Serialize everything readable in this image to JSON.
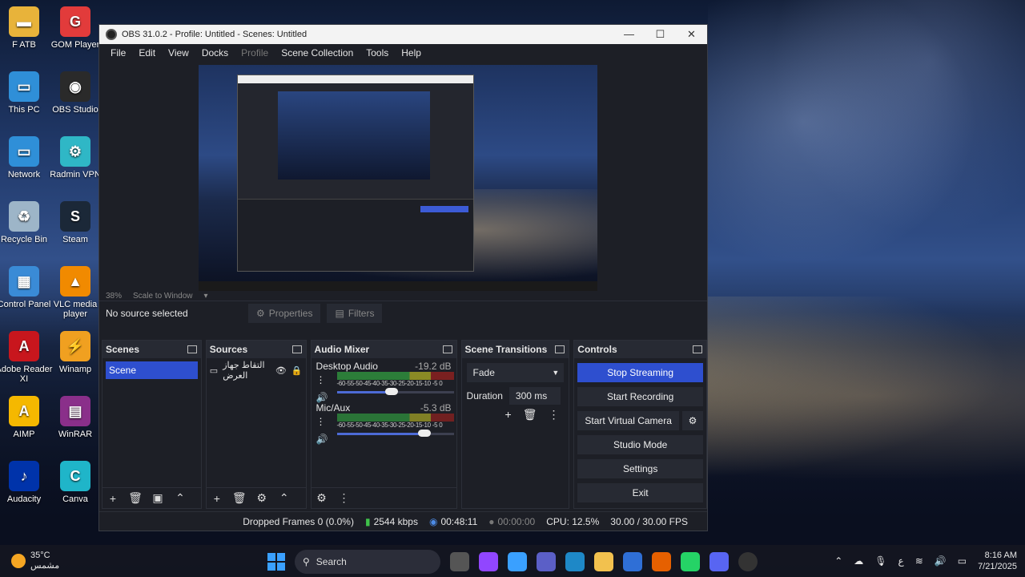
{
  "desktop_icons": [
    {
      "label": "F ATB",
      "color": "#e8b33a",
      "glyph": "▬"
    },
    {
      "label": "GOM Player",
      "color": "#e23b3b",
      "glyph": "G"
    },
    {
      "label": "This PC",
      "color": "#2f8fd8",
      "glyph": "▭"
    },
    {
      "label": "OBS Studio",
      "color": "#2a2a2a",
      "glyph": "◉"
    },
    {
      "label": "Network",
      "color": "#2f8fd8",
      "glyph": "▭"
    },
    {
      "label": "Radmin VPN",
      "color": "#2fb7c6",
      "glyph": "⚙"
    },
    {
      "label": "Recycle Bin",
      "color": "#9db5c8",
      "glyph": "♻"
    },
    {
      "label": "Steam",
      "color": "#1b2838",
      "glyph": "S"
    },
    {
      "label": "Control Panel",
      "color": "#3a8bd6",
      "glyph": "▦"
    },
    {
      "label": "VLC media player",
      "color": "#f18a00",
      "glyph": "▲"
    },
    {
      "label": "Adobe Reader XI",
      "color": "#c8161d",
      "glyph": "A"
    },
    {
      "label": "Winamp",
      "color": "#f0a020",
      "glyph": "⚡"
    },
    {
      "label": "AIMP",
      "color": "#f5b800",
      "glyph": "A"
    },
    {
      "label": "WinRAR",
      "color": "#8a2f8a",
      "glyph": "▤"
    },
    {
      "label": "Audacity",
      "color": "#0033aa",
      "glyph": "♪"
    },
    {
      "label": "Canva",
      "color": "#1fb5c9",
      "glyph": "C"
    }
  ],
  "window": {
    "title": "OBS 31.0.2 - Profile: Untitled - Scenes: Untitled",
    "minimize": "—",
    "maximize": "☐",
    "close": "✕"
  },
  "menu": {
    "file": "File",
    "edit": "Edit",
    "view": "View",
    "docks": "Docks",
    "profile": "Profile",
    "scene_collection": "Scene Collection",
    "tools": "Tools",
    "help": "Help"
  },
  "preview": {
    "zoom": "38%",
    "scale_mode": "Scale to Window"
  },
  "source_toolbar": {
    "no_source": "No source selected",
    "properties": "Properties",
    "filters": "Filters"
  },
  "scenes": {
    "title": "Scenes",
    "items": [
      "Scene"
    ]
  },
  "sources": {
    "title": "Sources",
    "items": [
      {
        "name": "التقاط جهاز العرض"
      }
    ]
  },
  "mixer": {
    "title": "Audio Mixer",
    "ticks": "-60-55-50-45-40-35-30-25-20-15-10 -5  0",
    "channels": [
      {
        "name": "Desktop Audio",
        "db": "-19.2 dB",
        "volume": 0.47
      },
      {
        "name": "Mic/Aux",
        "db": "-5.3 dB",
        "volume": 0.75
      }
    ]
  },
  "transitions": {
    "title": "Scene Transitions",
    "selected": "Fade",
    "duration_label": "Duration",
    "duration_value": "300 ms"
  },
  "controls": {
    "title": "Controls",
    "stop_streaming": "Stop Streaming",
    "start_recording": "Start Recording",
    "start_virtual_camera": "Start Virtual Camera",
    "studio_mode": "Studio Mode",
    "settings": "Settings",
    "exit": "Exit"
  },
  "status": {
    "dropped_frames": "Dropped Frames 0 (0.0%)",
    "bitrate": "2544 kbps",
    "stream_time": "00:48:11",
    "record_time": "00:00:00",
    "cpu": "CPU: 12.5%",
    "fps": "30.00 / 30.00 FPS"
  },
  "taskbar": {
    "temperature": "35°C",
    "weather": "مشمس",
    "search_placeholder": "Search",
    "lang": "ع",
    "time": "8:16 AM",
    "date": "7/21/2025"
  }
}
